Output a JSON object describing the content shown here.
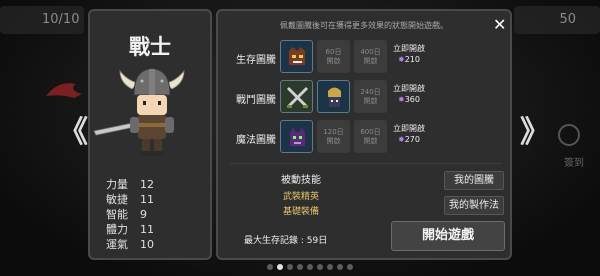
{
  "background": {
    "top_left_value": "10/10",
    "top_right_value": "50",
    "right_side_label": "簽到"
  },
  "navigation": {
    "prev_label": "《",
    "next_label": "》"
  },
  "character": {
    "class_name": "戰士",
    "stats": [
      {
        "label": "力量",
        "value": "12"
      },
      {
        "label": "敏捷",
        "value": "11"
      },
      {
        "label": "智能",
        "value": "9"
      },
      {
        "label": "體力",
        "value": "11"
      },
      {
        "label": "運氣",
        "value": "10"
      }
    ]
  },
  "panel": {
    "notice": "佩戴圖騰後可在獲得更多效果的狀態開始遊戲。",
    "close_label": "✕",
    "totems": [
      {
        "label": "生存圖騰",
        "slots": [
          {
            "filled": true,
            "icon": "demon-mask-icon"
          },
          {
            "filled": false,
            "days": "60日",
            "state": "開啟"
          },
          {
            "filled": false,
            "days": "400日",
            "state": "開啟"
          }
        ],
        "unlock_label": "立即開啟",
        "unlock_cost": "210"
      },
      {
        "label": "戰鬥圖騰",
        "slots": [
          {
            "filled": true,
            "icon": "crossed-swords-icon"
          },
          {
            "filled": true,
            "icon": "armored-knight-icon"
          },
          {
            "filled": false,
            "days": "240日",
            "state": "開啟"
          }
        ],
        "unlock_label": "立即開啟",
        "unlock_cost": "360"
      },
      {
        "label": "魔法圖騰",
        "slots": [
          {
            "filled": true,
            "icon": "purple-demon-icon"
          },
          {
            "filled": false,
            "days": "120日",
            "state": "開啟"
          },
          {
            "filled": false,
            "days": "600日",
            "state": "開啟"
          }
        ],
        "unlock_label": "立即開啟",
        "unlock_cost": "270"
      }
    ],
    "passive_title": "被動技能",
    "passives": [
      "武裝精英",
      "基礎裝備"
    ],
    "my_totems_label": "我的圖騰",
    "my_crafting_label": "我的製作法",
    "best_record": "最大生存記錄 :  59日",
    "start_label": "開始遊戲"
  },
  "pager": {
    "count": 9,
    "active_index": 1
  },
  "colors": {
    "gem": "#b07cf0",
    "passive": "#e5c46a",
    "filled_slot": "#1d3446"
  }
}
